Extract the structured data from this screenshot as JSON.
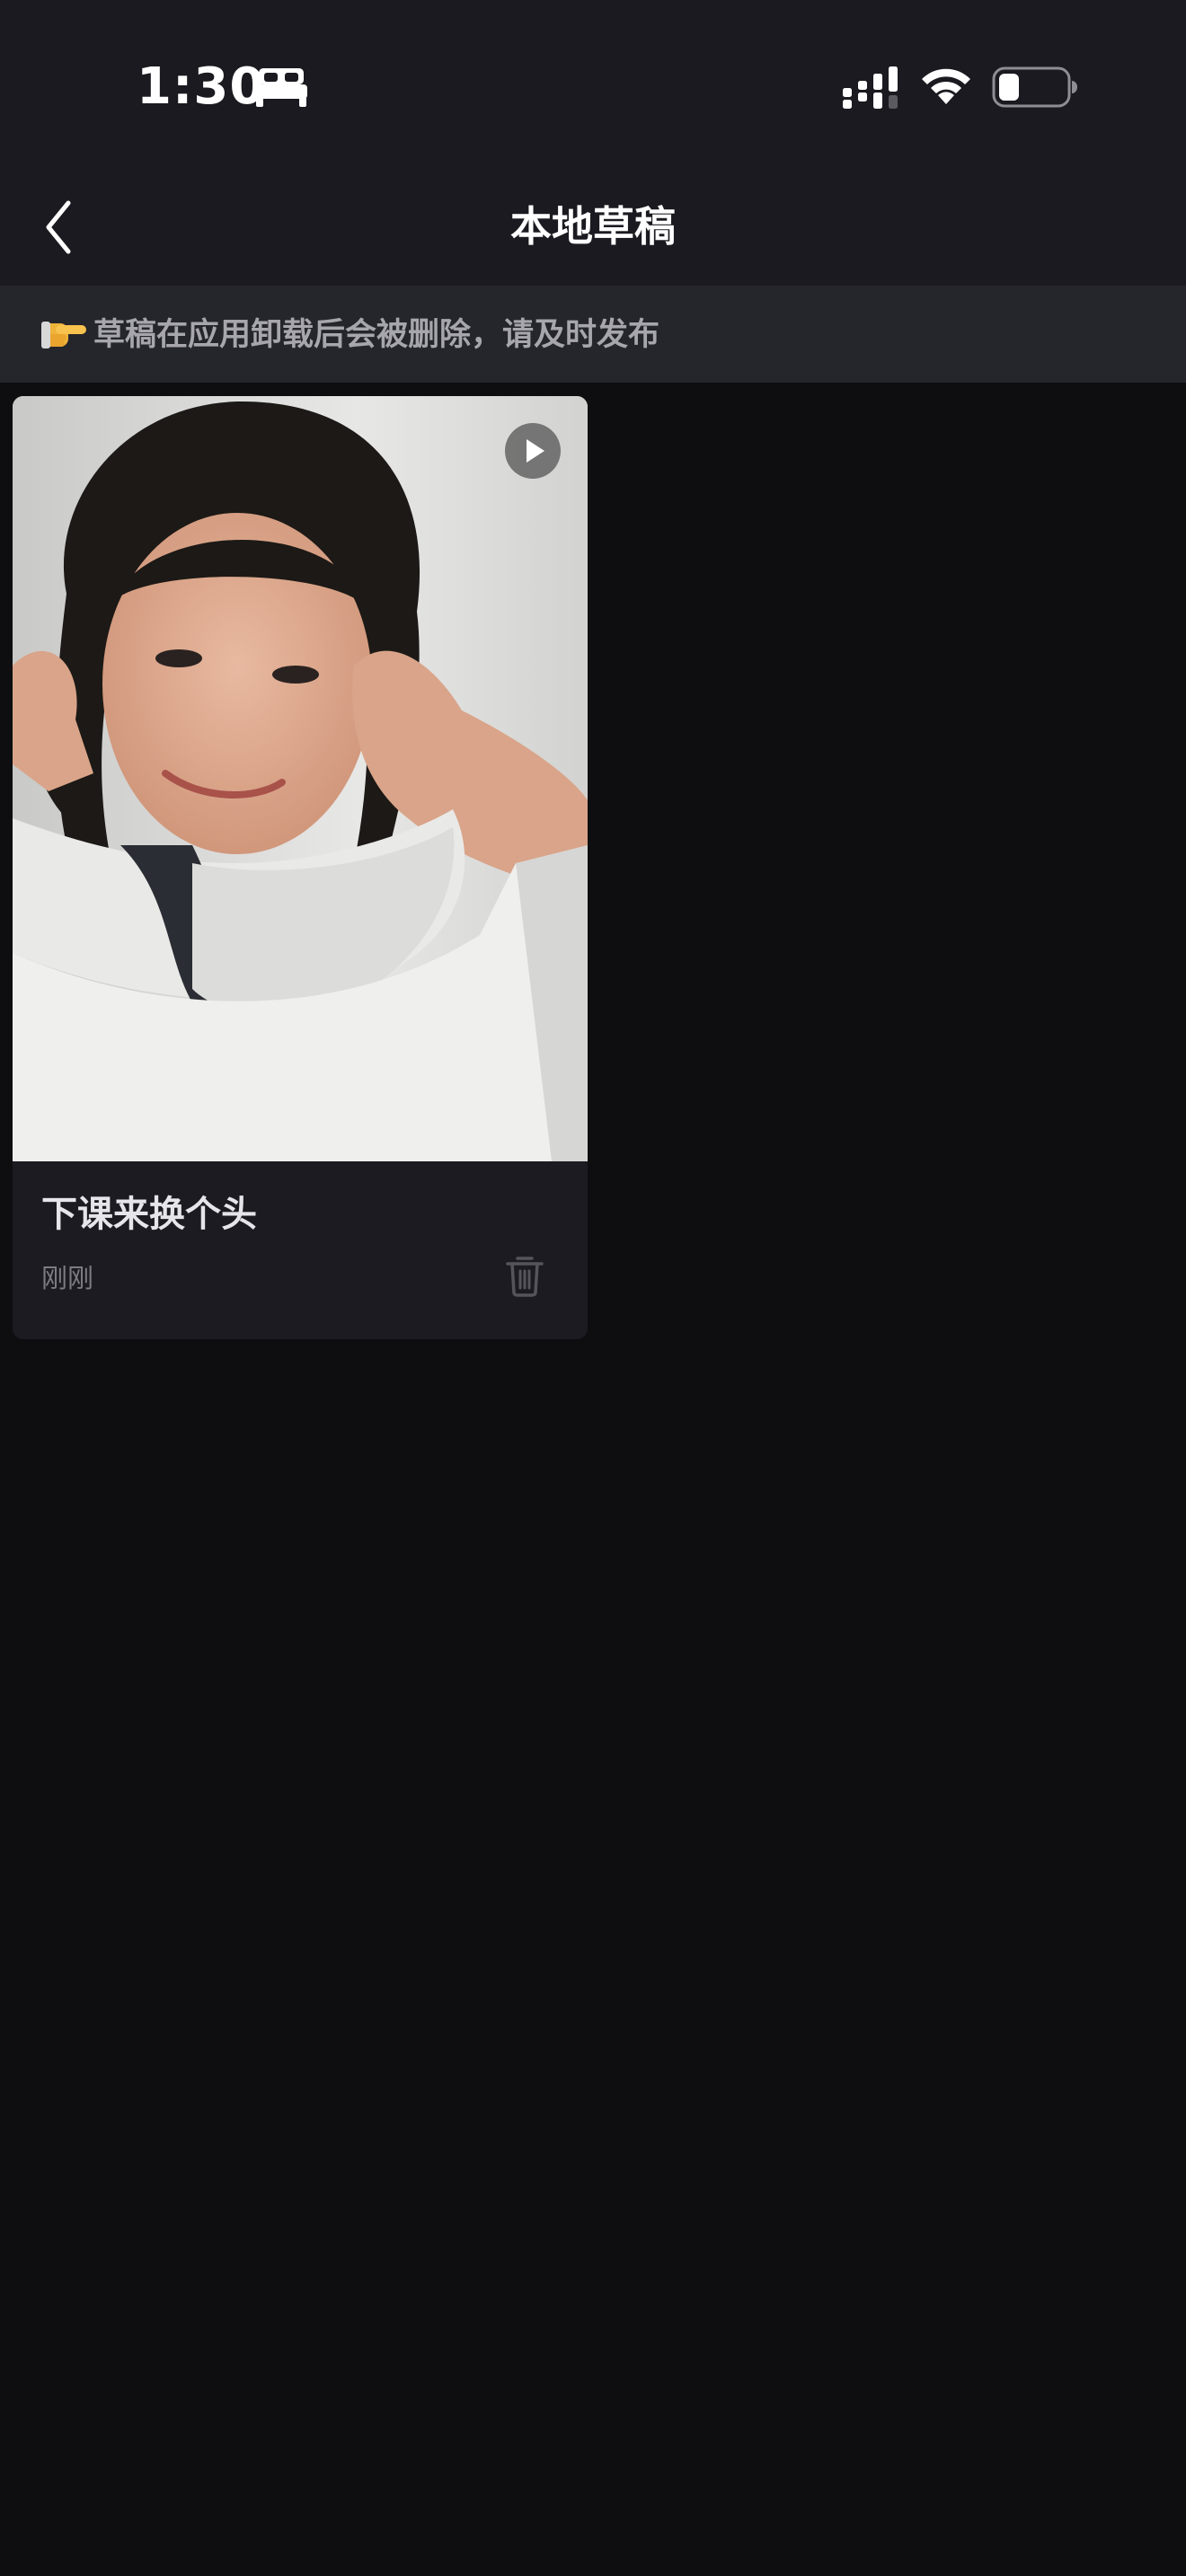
{
  "status_bar": {
    "time": "1:30",
    "focus_icon": "bed-icon",
    "signal_icon": "cellular-signal-icon",
    "wifi_icon": "wifi-icon",
    "battery_icon": "battery-icon",
    "battery_level": 0.2
  },
  "nav": {
    "back_icon": "chevron-left-icon",
    "title": "本地草稿"
  },
  "notice": {
    "emoji": "👉",
    "text": "草稿在应用卸载后会被删除，请及时发布"
  },
  "drafts": [
    {
      "title": "下课来换个头",
      "time": "刚刚",
      "play_icon": "play-icon",
      "delete_icon": "trash-icon"
    }
  ],
  "colors": {
    "background": "#0e0e11",
    "top_bar": "#1b1a20",
    "notice_bg": "#25252c",
    "card_bg": "#1c1b21",
    "title_text": "#ffffff",
    "muted_text": "#7d7c83"
  }
}
